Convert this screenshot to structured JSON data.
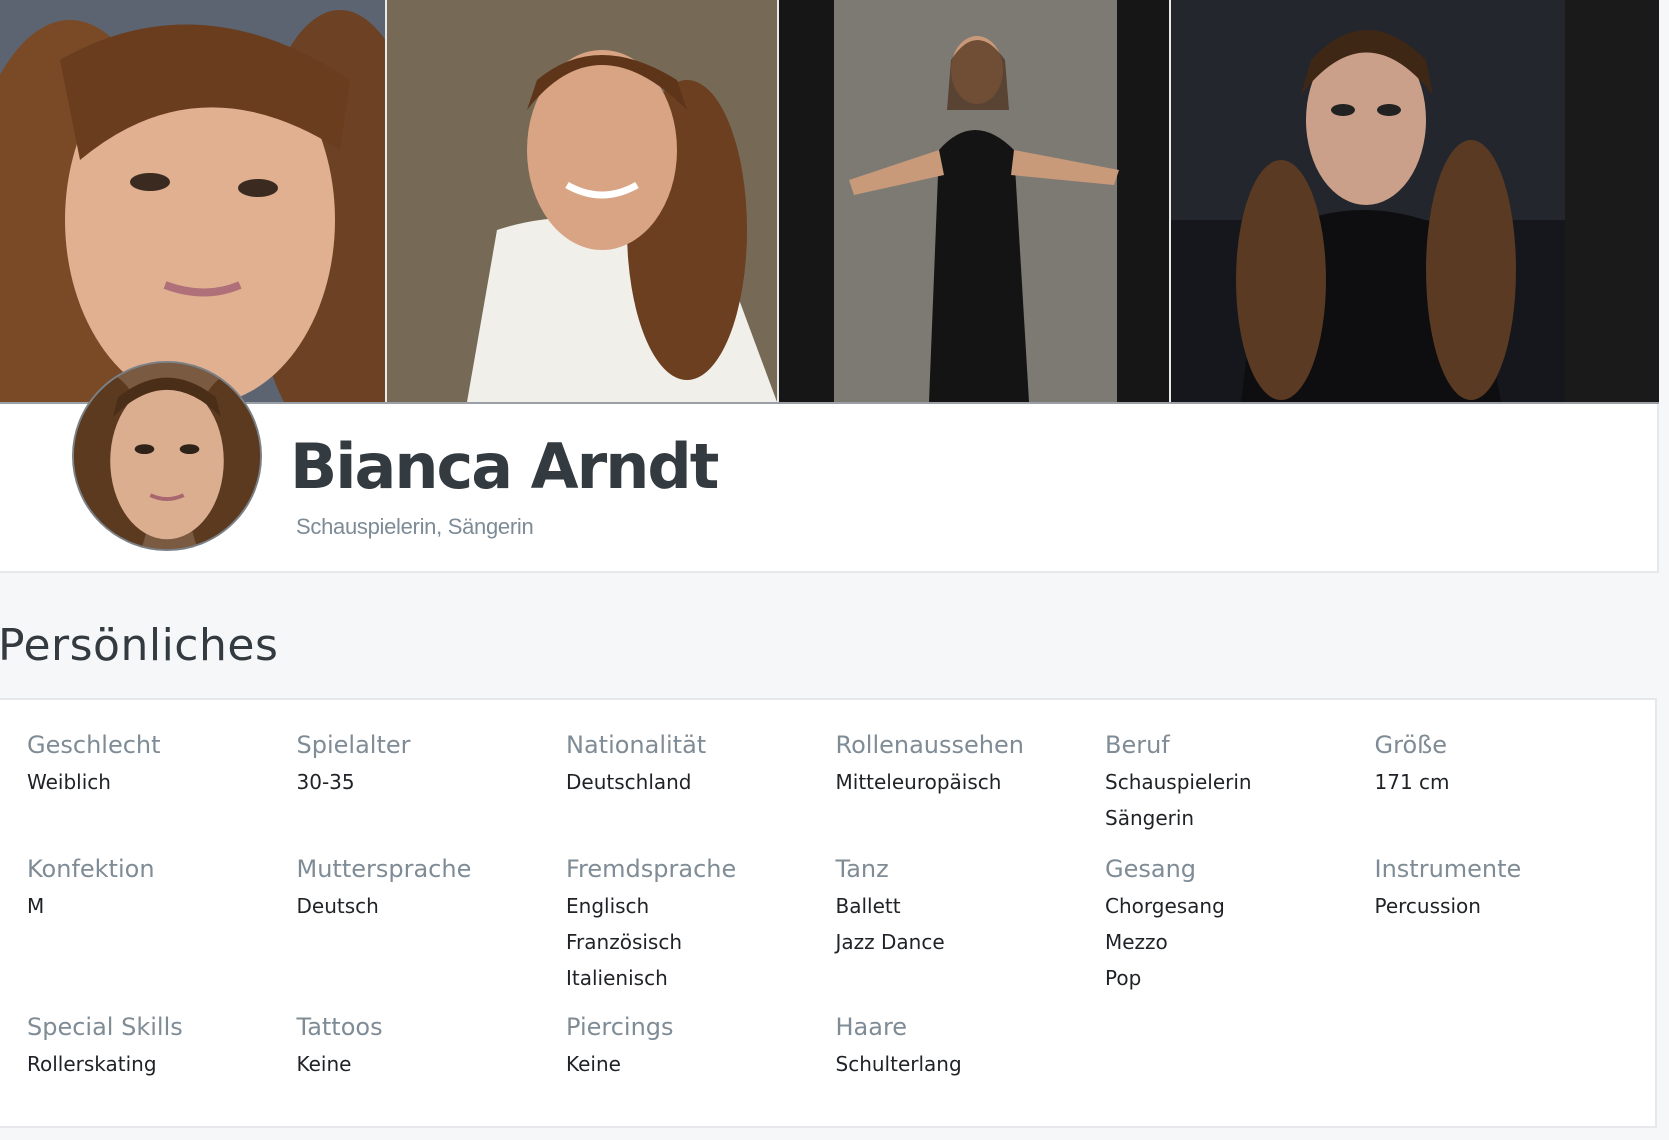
{
  "gallery": {
    "photos": [
      {
        "icon": "portrait-closeup-photo"
      },
      {
        "icon": "portrait-smiling-photo"
      },
      {
        "icon": "portrait-full-body-photo"
      },
      {
        "icon": "portrait-dark-photo"
      }
    ]
  },
  "profile": {
    "name": "Bianca Arndt",
    "profession": "Schauspielerin, Sängerin",
    "avatar_icon": "avatar-photo"
  },
  "section": {
    "title": "Persönliches"
  },
  "attributes": [
    {
      "label": "Geschlecht",
      "values": [
        "Weiblich"
      ]
    },
    {
      "label": "Spielalter",
      "values": [
        "30-35"
      ]
    },
    {
      "label": "Nationalität",
      "values": [
        "Deutschland"
      ]
    },
    {
      "label": "Rollenaussehen",
      "values": [
        "Mitteleuropäisch"
      ]
    },
    {
      "label": "Beruf",
      "values": [
        "Schauspielerin",
        "Sängerin"
      ]
    },
    {
      "label": "Größe",
      "values": [
        "171 cm"
      ]
    },
    {
      "label": "Konfektion",
      "values": [
        "M"
      ]
    },
    {
      "label": "Muttersprache",
      "values": [
        "Deutsch"
      ]
    },
    {
      "label": "Fremdsprache",
      "values": [
        "Englisch",
        "Französisch",
        "Italienisch"
      ]
    },
    {
      "label": "Tanz",
      "values": [
        "Ballett",
        "Jazz Dance"
      ]
    },
    {
      "label": "Gesang",
      "values": [
        "Chorgesang",
        "Mezzo",
        "Pop"
      ]
    },
    {
      "label": "Instrumente",
      "values": [
        "Percussion"
      ]
    },
    {
      "label": "Special Skills",
      "values": [
        "Rollerskating"
      ]
    },
    {
      "label": "Tattoos",
      "values": [
        "Keine"
      ]
    },
    {
      "label": "Piercings",
      "values": [
        "Keine"
      ]
    },
    {
      "label": "Haare",
      "values": [
        "Schulterlang"
      ]
    }
  ],
  "colors": {
    "page_bg": "#f6f7f9",
    "card_bg": "#ffffff",
    "heading": "#333b40",
    "muted": "#7f8c96",
    "text": "#1f2226"
  }
}
